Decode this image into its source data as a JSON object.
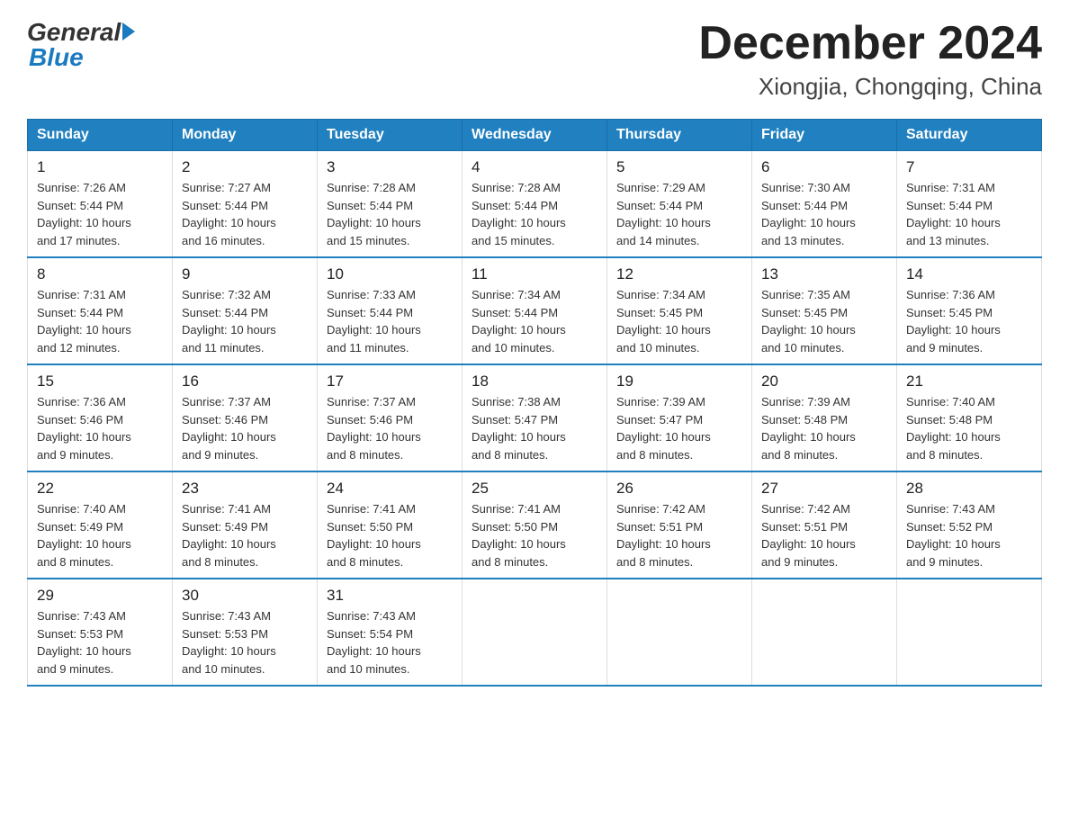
{
  "header": {
    "logo": {
      "general": "General",
      "blue": "Blue"
    },
    "title": "December 2024",
    "location": "Xiongjia, Chongqing, China"
  },
  "weekdays": [
    "Sunday",
    "Monday",
    "Tuesday",
    "Wednesday",
    "Thursday",
    "Friday",
    "Saturday"
  ],
  "weeks": [
    [
      {
        "day": "1",
        "sunrise": "7:26 AM",
        "sunset": "5:44 PM",
        "daylight": "10 hours and 17 minutes."
      },
      {
        "day": "2",
        "sunrise": "7:27 AM",
        "sunset": "5:44 PM",
        "daylight": "10 hours and 16 minutes."
      },
      {
        "day": "3",
        "sunrise": "7:28 AM",
        "sunset": "5:44 PM",
        "daylight": "10 hours and 15 minutes."
      },
      {
        "day": "4",
        "sunrise": "7:28 AM",
        "sunset": "5:44 PM",
        "daylight": "10 hours and 15 minutes."
      },
      {
        "day": "5",
        "sunrise": "7:29 AM",
        "sunset": "5:44 PM",
        "daylight": "10 hours and 14 minutes."
      },
      {
        "day": "6",
        "sunrise": "7:30 AM",
        "sunset": "5:44 PM",
        "daylight": "10 hours and 13 minutes."
      },
      {
        "day": "7",
        "sunrise": "7:31 AM",
        "sunset": "5:44 PM",
        "daylight": "10 hours and 13 minutes."
      }
    ],
    [
      {
        "day": "8",
        "sunrise": "7:31 AM",
        "sunset": "5:44 PM",
        "daylight": "10 hours and 12 minutes."
      },
      {
        "day": "9",
        "sunrise": "7:32 AM",
        "sunset": "5:44 PM",
        "daylight": "10 hours and 11 minutes."
      },
      {
        "day": "10",
        "sunrise": "7:33 AM",
        "sunset": "5:44 PM",
        "daylight": "10 hours and 11 minutes."
      },
      {
        "day": "11",
        "sunrise": "7:34 AM",
        "sunset": "5:44 PM",
        "daylight": "10 hours and 10 minutes."
      },
      {
        "day": "12",
        "sunrise": "7:34 AM",
        "sunset": "5:45 PM",
        "daylight": "10 hours and 10 minutes."
      },
      {
        "day": "13",
        "sunrise": "7:35 AM",
        "sunset": "5:45 PM",
        "daylight": "10 hours and 10 minutes."
      },
      {
        "day": "14",
        "sunrise": "7:36 AM",
        "sunset": "5:45 PM",
        "daylight": "10 hours and 9 minutes."
      }
    ],
    [
      {
        "day": "15",
        "sunrise": "7:36 AM",
        "sunset": "5:46 PM",
        "daylight": "10 hours and 9 minutes."
      },
      {
        "day": "16",
        "sunrise": "7:37 AM",
        "sunset": "5:46 PM",
        "daylight": "10 hours and 9 minutes."
      },
      {
        "day": "17",
        "sunrise": "7:37 AM",
        "sunset": "5:46 PM",
        "daylight": "10 hours and 8 minutes."
      },
      {
        "day": "18",
        "sunrise": "7:38 AM",
        "sunset": "5:47 PM",
        "daylight": "10 hours and 8 minutes."
      },
      {
        "day": "19",
        "sunrise": "7:39 AM",
        "sunset": "5:47 PM",
        "daylight": "10 hours and 8 minutes."
      },
      {
        "day": "20",
        "sunrise": "7:39 AM",
        "sunset": "5:48 PM",
        "daylight": "10 hours and 8 minutes."
      },
      {
        "day": "21",
        "sunrise": "7:40 AM",
        "sunset": "5:48 PM",
        "daylight": "10 hours and 8 minutes."
      }
    ],
    [
      {
        "day": "22",
        "sunrise": "7:40 AM",
        "sunset": "5:49 PM",
        "daylight": "10 hours and 8 minutes."
      },
      {
        "day": "23",
        "sunrise": "7:41 AM",
        "sunset": "5:49 PM",
        "daylight": "10 hours and 8 minutes."
      },
      {
        "day": "24",
        "sunrise": "7:41 AM",
        "sunset": "5:50 PM",
        "daylight": "10 hours and 8 minutes."
      },
      {
        "day": "25",
        "sunrise": "7:41 AM",
        "sunset": "5:50 PM",
        "daylight": "10 hours and 8 minutes."
      },
      {
        "day": "26",
        "sunrise": "7:42 AM",
        "sunset": "5:51 PM",
        "daylight": "10 hours and 8 minutes."
      },
      {
        "day": "27",
        "sunrise": "7:42 AM",
        "sunset": "5:51 PM",
        "daylight": "10 hours and 9 minutes."
      },
      {
        "day": "28",
        "sunrise": "7:43 AM",
        "sunset": "5:52 PM",
        "daylight": "10 hours and 9 minutes."
      }
    ],
    [
      {
        "day": "29",
        "sunrise": "7:43 AM",
        "sunset": "5:53 PM",
        "daylight": "10 hours and 9 minutes."
      },
      {
        "day": "30",
        "sunrise": "7:43 AM",
        "sunset": "5:53 PM",
        "daylight": "10 hours and 10 minutes."
      },
      {
        "day": "31",
        "sunrise": "7:43 AM",
        "sunset": "5:54 PM",
        "daylight": "10 hours and 10 minutes."
      },
      null,
      null,
      null,
      null
    ]
  ],
  "labels": {
    "sunrise": "Sunrise:",
    "sunset": "Sunset:",
    "daylight": "Daylight:"
  }
}
